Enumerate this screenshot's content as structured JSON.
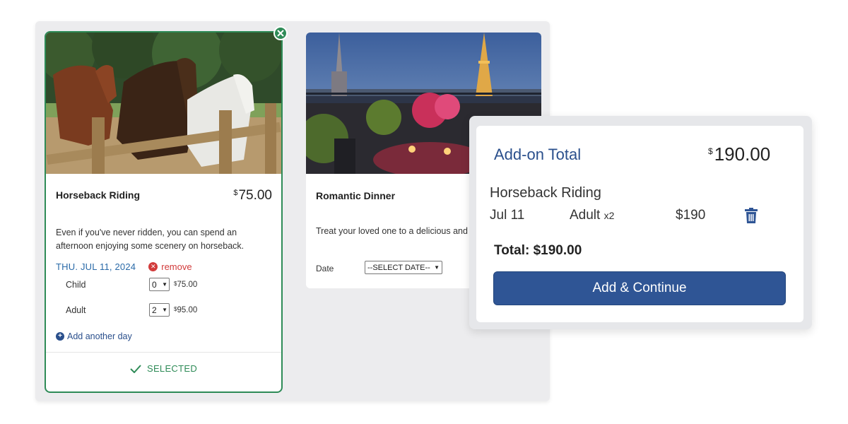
{
  "cards": [
    {
      "title": "Horseback Riding",
      "price_symbol": "$",
      "price_amount": "75.00",
      "description": "Even if you've never ridden, you can spend an afternoon enjoying some scenery on horseback.",
      "date": "THU. JUL 11, 2024",
      "remove_label": "remove",
      "rows": [
        {
          "label": "Child",
          "qty": "0",
          "price_symbol": "$",
          "price": "75.00"
        },
        {
          "label": "Adult",
          "qty": "2",
          "price_symbol": "$",
          "price": "95.00"
        }
      ],
      "add_day_label": "Add another day",
      "selected_label": "SELECTED"
    },
    {
      "title": "Romantic Dinner",
      "description": "Treat your loved one to a delicious and ro",
      "date_label": "Date",
      "date_select": "--SELECT DATE--"
    }
  ],
  "summary": {
    "title": "Add-on Total",
    "total_symbol": "$",
    "total_amount": "190.00",
    "item_name": "Horseback Riding",
    "item_date": "Jul 11",
    "item_type": "Adult",
    "item_qty": "x2",
    "item_price": "$190",
    "grand_total": "Total: $190.00",
    "button_label": "Add & Continue"
  },
  "colors": {
    "selected_green": "#2e8b57",
    "brand_blue": "#2f5595",
    "date_blue": "#2a6aa8",
    "remove_red": "#d23b3b"
  }
}
